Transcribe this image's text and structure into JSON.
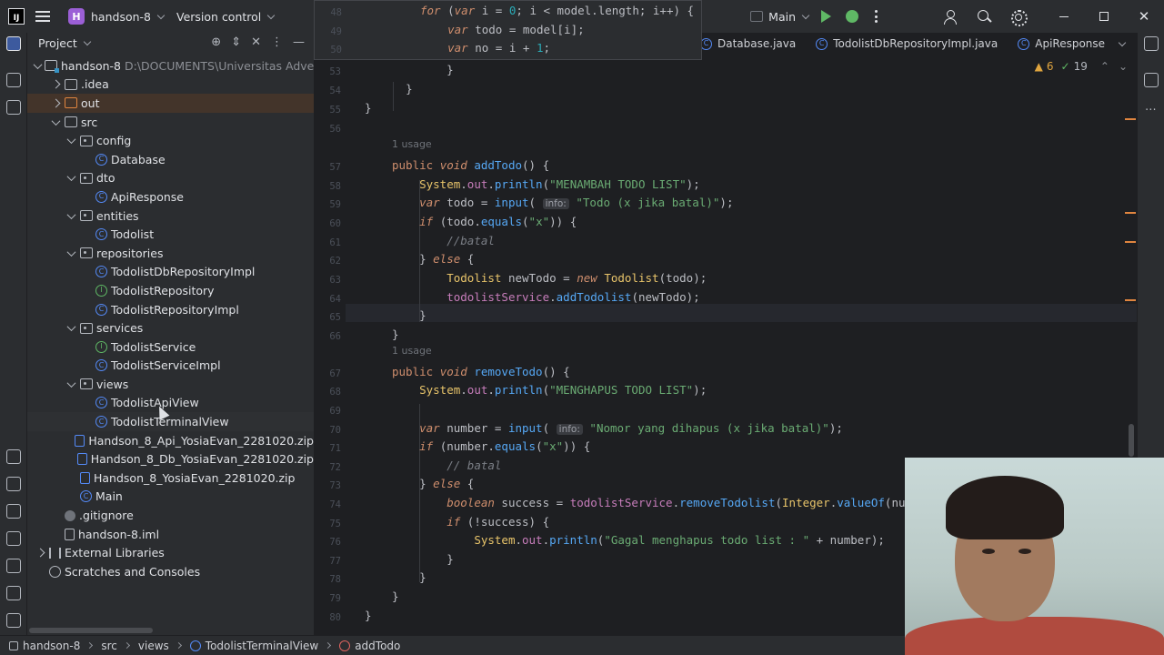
{
  "titlebar": {
    "app_logo": "IJ",
    "project_badge": "H",
    "project_name": "handson-8",
    "vcs": "Version control",
    "run_config": "Main",
    "icons": [
      "user-icon",
      "search-icon",
      "gear-icon",
      "minimize-icon",
      "maximize-icon",
      "close-icon"
    ]
  },
  "project_panel": {
    "title": "Project",
    "tree": [
      {
        "label": "handson-8",
        "suffix": "D:\\DOCUMENTS\\Universitas Adver",
        "icon": "module",
        "arrow": "down",
        "depth": 0
      },
      {
        "label": ".idea",
        "icon": "folder",
        "arrow": "right",
        "depth": 1
      },
      {
        "label": "out",
        "icon": "folder-orange",
        "arrow": "right",
        "depth": 1,
        "selected": true
      },
      {
        "label": "src",
        "icon": "folder",
        "arrow": "down",
        "depth": 1
      },
      {
        "label": "config",
        "icon": "package",
        "arrow": "down",
        "depth": 2
      },
      {
        "label": "Database",
        "icon": "class",
        "depth": 3
      },
      {
        "label": "dto",
        "icon": "package",
        "arrow": "down",
        "depth": 2
      },
      {
        "label": "ApiResponse",
        "icon": "class",
        "depth": 3
      },
      {
        "label": "entities",
        "icon": "package",
        "arrow": "down",
        "depth": 2
      },
      {
        "label": "Todolist",
        "icon": "class",
        "depth": 3
      },
      {
        "label": "repositories",
        "icon": "package",
        "arrow": "down",
        "depth": 2
      },
      {
        "label": "TodolistDbRepositoryImpl",
        "icon": "class",
        "depth": 3
      },
      {
        "label": "TodolistRepository",
        "icon": "interface",
        "depth": 3
      },
      {
        "label": "TodolistRepositoryImpl",
        "icon": "class",
        "depth": 3
      },
      {
        "label": "services",
        "icon": "package",
        "arrow": "down",
        "depth": 2
      },
      {
        "label": "TodolistService",
        "icon": "interface",
        "depth": 3
      },
      {
        "label": "TodolistServiceImpl",
        "icon": "class",
        "depth": 3
      },
      {
        "label": "views",
        "icon": "package",
        "arrow": "down",
        "depth": 2
      },
      {
        "label": "TodolistApiView",
        "icon": "class",
        "depth": 3
      },
      {
        "label": "TodolistTerminalView",
        "icon": "class",
        "depth": 3,
        "hover": true
      },
      {
        "label": "Handson_8_Api_YosiaEvan_2281020.zip",
        "icon": "zip",
        "depth": 2
      },
      {
        "label": "Handson_8_Db_YosiaEvan_2281020.zip",
        "icon": "zip",
        "depth": 2
      },
      {
        "label": "Handson_8_YosiaEvan_2281020.zip",
        "icon": "zip",
        "depth": 2
      },
      {
        "label": "Main",
        "icon": "class",
        "depth": 2
      },
      {
        "label": ".gitignore",
        "icon": "gitignore",
        "depth": 1
      },
      {
        "label": "handson-8.iml",
        "icon": "iml",
        "depth": 1
      },
      {
        "label": "External Libraries",
        "icon": "library",
        "arrow": "right",
        "depth": 0
      },
      {
        "label": "Scratches and Consoles",
        "icon": "scratches",
        "depth": 0
      }
    ]
  },
  "editor": {
    "tabs": [
      "Database.java",
      "TodolistDbRepositoryImpl.java",
      "ApiResponse"
    ],
    "warnings": "6",
    "checks": "19",
    "usage_label": "1 usage"
  },
  "statusbar": {
    "crumbs": [
      "handson-8",
      "src",
      "views",
      "TodolistTerminalView",
      "addTodo"
    ]
  }
}
